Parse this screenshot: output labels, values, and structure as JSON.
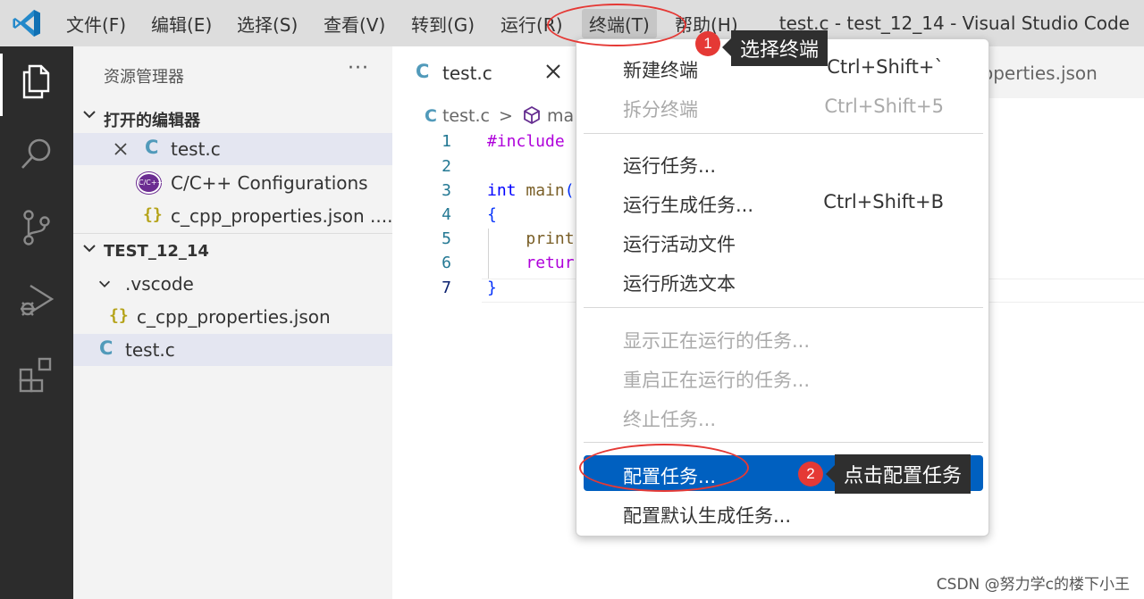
{
  "menubar": {
    "logo_icon": "vscode-logo-icon",
    "items": [
      {
        "label": "文件(F)"
      },
      {
        "label": "编辑(E)"
      },
      {
        "label": "选择(S)"
      },
      {
        "label": "查看(V)"
      },
      {
        "label": "转到(G)"
      },
      {
        "label": "运行(R)"
      },
      {
        "label": "终端(T)"
      },
      {
        "label": "帮助(H)"
      }
    ],
    "window_title": "test.c - test_12_14 - Visual Studio Code"
  },
  "activitybar": {
    "icons": [
      "explorer-icon",
      "search-icon",
      "source-control-icon",
      "run-debug-icon",
      "extensions-icon"
    ]
  },
  "sidebar": {
    "title": "资源管理器",
    "more": "···",
    "open_editors": {
      "header": "打开的编辑器",
      "items": [
        {
          "label": "test.c",
          "icon": "C"
        },
        {
          "label": "C/C++ Configurations",
          "icon": "C/C++"
        },
        {
          "label": "c_cpp_properties.json  ....",
          "icon": "{}"
        }
      ]
    },
    "workspace": {
      "header": "TEST_12_14",
      "items": [
        {
          "label": ".vscode"
        },
        {
          "label": "c_cpp_properties.json",
          "icon": "{}"
        },
        {
          "label": "test.c",
          "icon": "C"
        }
      ]
    }
  },
  "editor": {
    "tab_active": {
      "label": "test.c",
      "icon": "C"
    },
    "tab_other": {
      "label": "operties.json"
    },
    "breadcrumb": {
      "file": "test.c",
      "sep": ">",
      "symbol": "ma"
    },
    "lines": [
      {
        "n": "1",
        "parts": [
          {
            "t": "#include",
            "c": "kw-purple"
          }
        ]
      },
      {
        "n": "2",
        "parts": []
      },
      {
        "n": "3",
        "parts": [
          {
            "t": "int",
            "c": "kw-blue"
          },
          {
            "t": " ",
            "c": ""
          },
          {
            "t": "main",
            "c": "fn"
          },
          {
            "t": "(",
            "c": "punct"
          }
        ]
      },
      {
        "n": "4",
        "parts": [
          {
            "t": "{",
            "c": "punct"
          }
        ]
      },
      {
        "n": "5",
        "parts": [
          {
            "t": "    ",
            "c": ""
          },
          {
            "t": "print",
            "c": "fn"
          }
        ]
      },
      {
        "n": "6",
        "parts": [
          {
            "t": "    ",
            "c": ""
          },
          {
            "t": "retur",
            "c": "kw-purple"
          }
        ]
      },
      {
        "n": "7",
        "parts": [
          {
            "t": "}",
            "c": "punct"
          }
        ]
      }
    ]
  },
  "dropdown": {
    "items": [
      {
        "label": "新建终端",
        "kb": "Ctrl+Shift+`",
        "state": "normal"
      },
      {
        "label": "拆分终端",
        "kb": "Ctrl+Shift+5",
        "state": "disabled"
      },
      {
        "label": "运行任务...",
        "kb": "",
        "state": "normal"
      },
      {
        "label": "运行生成任务...",
        "kb": "Ctrl+Shift+B",
        "state": "normal"
      },
      {
        "label": "运行活动文件",
        "kb": "",
        "state": "normal"
      },
      {
        "label": "运行所选文本",
        "kb": "",
        "state": "normal"
      },
      {
        "label": "显示正在运行的任务...",
        "kb": "",
        "state": "disabled"
      },
      {
        "label": "重启正在运行的任务...",
        "kb": "",
        "state": "disabled"
      },
      {
        "label": "终止任务...",
        "kb": "",
        "state": "disabled"
      },
      {
        "label": "配置任务...",
        "kb": "",
        "state": "highlight"
      },
      {
        "label": "配置默认生成任务...",
        "kb": "",
        "state": "normal"
      }
    ]
  },
  "annotations": {
    "step1": {
      "badge": "1",
      "text": "选择终端"
    },
    "step2": {
      "badge": "2",
      "text": "点击配置任务"
    }
  },
  "watermark": "CSDN @努力学c的楼下小王",
  "colors": {
    "menubar_bg": "#dddddd",
    "activitybar_bg": "#2c2c2c",
    "sidebar_bg": "#f3f3f3",
    "highlight": "#0060c0",
    "annotation_red": "#e53935"
  }
}
